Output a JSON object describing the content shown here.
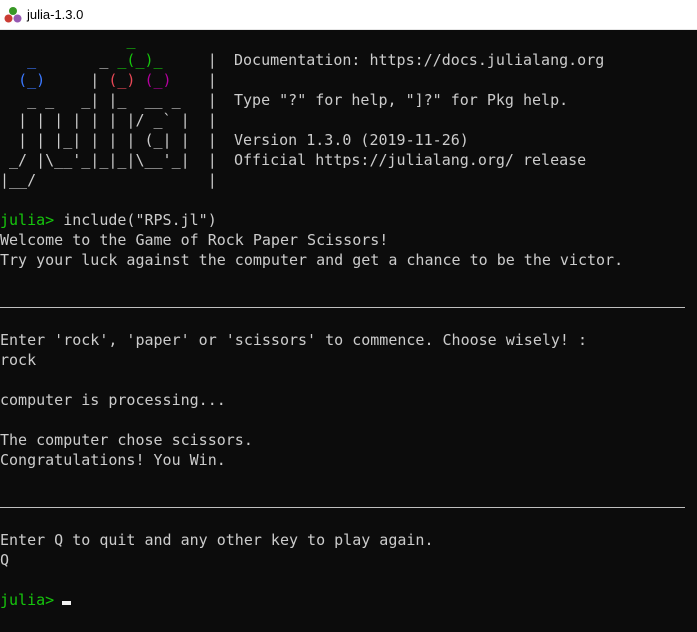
{
  "window": {
    "title": "julia-1.3.0",
    "icon": "julia-logo-icon"
  },
  "colors": {
    "background": "#0c0c0c",
    "text": "#cccccc",
    "prompt_green": "#16c60c",
    "logo_blue": "#3b78ff",
    "logo_red": "#e74856",
    "logo_purple": "#b4009e"
  },
  "banner": {
    "documentation": "Documentation: https://docs.julialang.org",
    "help": "Type \"?\" for help, \"]?\" for Pkg help.",
    "version": "Version 1.3.0 (2019-11-26)",
    "official": "Official https://julialang.org/ release"
  },
  "session": {
    "prompt": "julia>",
    "command": " include(\"RPS.jl\")",
    "welcome": "Welcome to the Game of Rock Paper Scissors!",
    "tagline": "Try your luck against the computer and get a chance to be the victor.",
    "enter_choice": "Enter 'rock', 'paper' or 'scissors' to commence. Choose wisely! :",
    "user_choice": "rock",
    "processing": "computer is processing...",
    "computer_chose": "The computer chose scissors.",
    "result": "Congratulations! You Win.",
    "play_again": "Enter Q to quit and any other key to play again.",
    "user_quit": "Q",
    "final_prompt": "julia>"
  }
}
